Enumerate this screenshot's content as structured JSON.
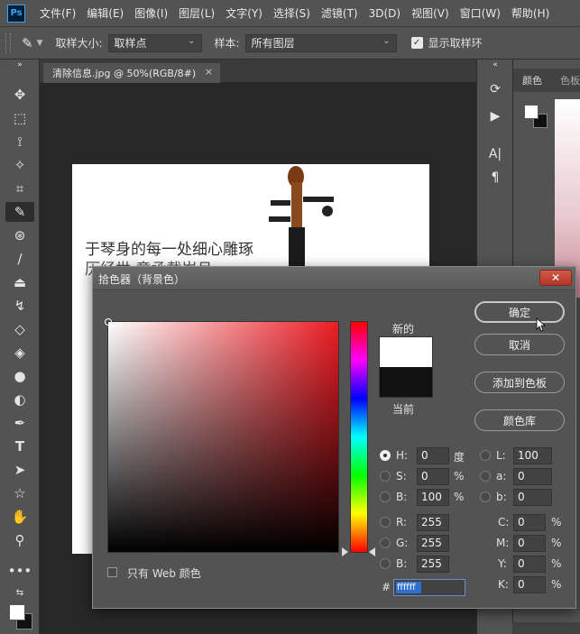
{
  "menubar": {
    "logo": "Ps",
    "items": [
      "文件(F)",
      "编辑(E)",
      "图像(I)",
      "图层(L)",
      "文字(Y)",
      "选择(S)",
      "滤镜(T)",
      "3D(D)",
      "视图(V)",
      "窗口(W)",
      "帮助(H)"
    ]
  },
  "options": {
    "sample_size_label": "取样大小:",
    "sample_size_value": "取样点",
    "sample_label": "样本:",
    "sample_value": "所有图层",
    "show_ring_label": "显示取样环"
  },
  "document": {
    "tab_title": "清除信息.jpg @ 50%(RGB/8#)",
    "tab_close": "×",
    "photo_line1": "于琴身的每一处细心雕琢",
    "photo_line2": "历经世 意承载岁月"
  },
  "right_panel": {
    "tab_color": "颜色",
    "tab_swatches": "色板"
  },
  "dialog": {
    "title": "拾色器（背景色）",
    "close": "✕",
    "label_new": "新的",
    "label_current": "当前",
    "btn_ok": "确定",
    "btn_cancel": "取消",
    "btn_add_swatch": "添加到色板",
    "btn_libraries": "颜色库",
    "web_only_label": "只有 Web 颜色",
    "hsb": {
      "h_label": "H:",
      "h_value": "0",
      "h_unit": "度",
      "s_label": "S:",
      "s_value": "0",
      "s_unit": "%",
      "b_label": "B:",
      "b_value": "100",
      "b_unit": "%"
    },
    "rgb": {
      "r_label": "R:",
      "r_value": "255",
      "g_label": "G:",
      "g_value": "255",
      "b_label": "B:",
      "b_value": "255"
    },
    "lab": {
      "l_label": "L:",
      "l_value": "100",
      "a_label": "a:",
      "a_value": "0",
      "b_label": "b:",
      "b_value": "0"
    },
    "cmyk": {
      "c_label": "C:",
      "c_value": "0",
      "c_unit": "%",
      "m_label": "M:",
      "m_value": "0",
      "m_unit": "%",
      "y_label": "Y:",
      "y_value": "0",
      "y_unit": "%",
      "k_label": "K:",
      "k_value": "0",
      "k_unit": "%"
    },
    "hex_label": "#",
    "hex_value": "ffffff",
    "new_color": "#ffffff",
    "current_color": "#111111",
    "hue_color": "#ed1c24"
  },
  "colors": {
    "ui_bg": "#535353",
    "canvas_bg": "#282828",
    "accent": "#31a8ff"
  }
}
